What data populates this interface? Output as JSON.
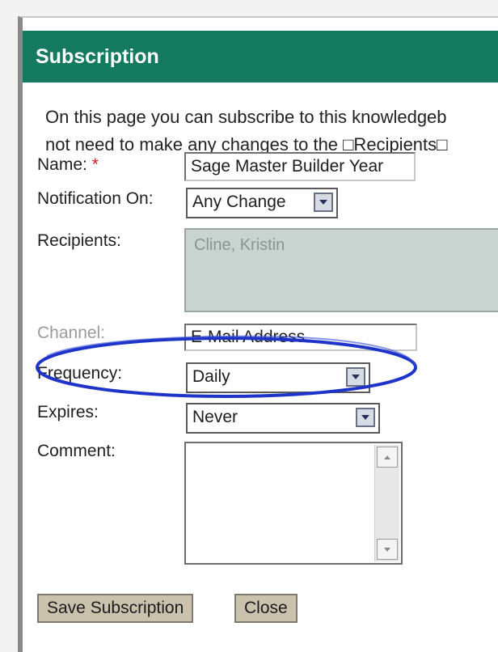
{
  "title": "Subscription",
  "intro": {
    "line1": "On this page you can subscribe to this knowledgeb",
    "line2": "not need to make any changes to the □Recipients□"
  },
  "form": {
    "name_label": "Name:",
    "required_mark": "*",
    "name_value": "Sage Master Builder Year",
    "notification_label": "Notification On:",
    "notification_value": "Any Change",
    "recipients_label": "Recipients:",
    "recipients_value": "Cline, Kristin",
    "channel_label": "Channel:",
    "channel_value": "E-Mail Address",
    "frequency_label": "Frequency:",
    "frequency_value": "Daily",
    "expires_label": "Expires:",
    "expires_value": "Never",
    "comment_label": "Comment:",
    "comment_value": ""
  },
  "buttons": {
    "save": "Save Subscription",
    "close": "Close"
  },
  "colors": {
    "title_bar": "#13795f",
    "highlight_oval": "#1e34c8",
    "required": "#d21a1a"
  }
}
